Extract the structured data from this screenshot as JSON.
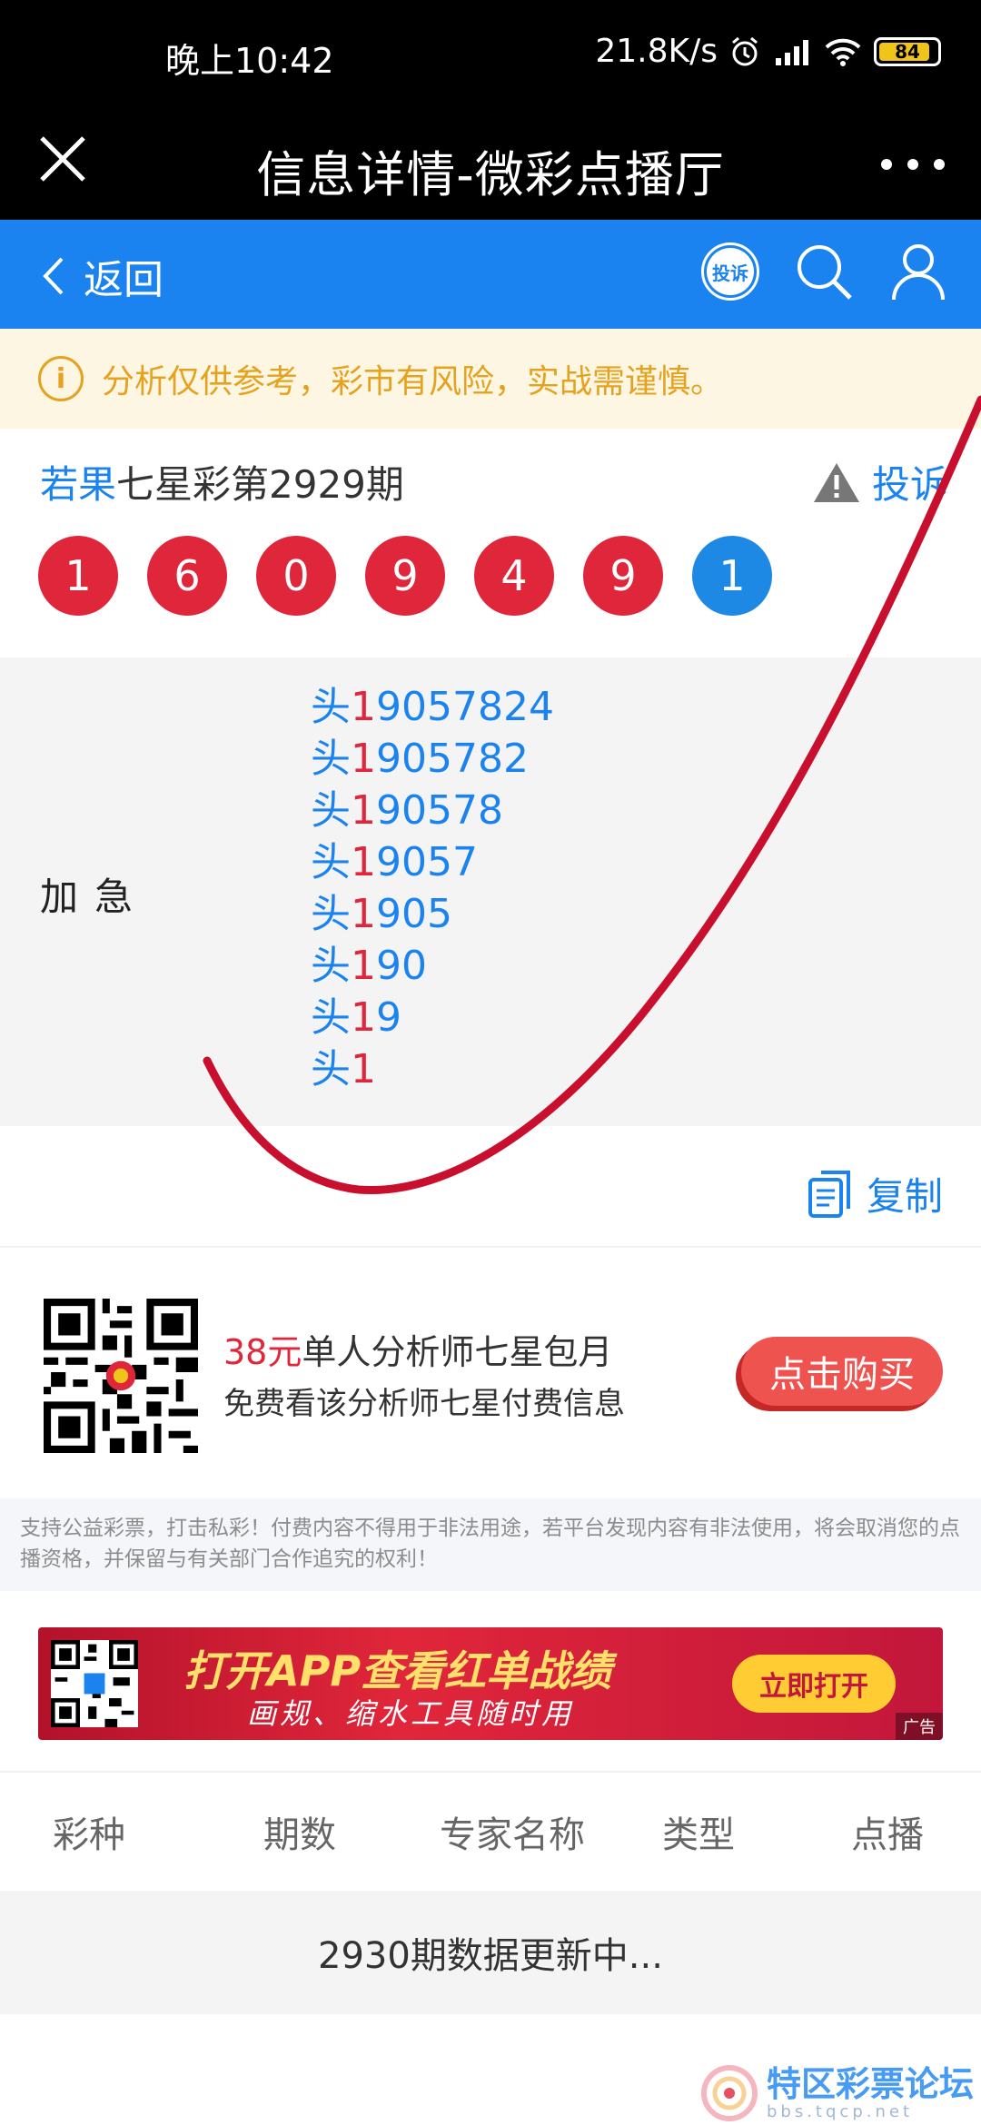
{
  "status_bar": {
    "time": "晚上10:42",
    "net_speed": "21.8K/s",
    "battery": "84"
  },
  "title_bar": {
    "title": "信息详情-微彩点播厅"
  },
  "nav": {
    "back_label": "返回",
    "complain_badge": "投诉"
  },
  "notice": {
    "text": "分析仅供参考，彩市有风险，实战需谨慎。"
  },
  "issue": {
    "author": "若果",
    "title": "七星彩第2929期",
    "report_label": "投诉"
  },
  "balls": {
    "b1": "1",
    "b2": "6",
    "b3": "0",
    "b4": "9",
    "b5": "4",
    "b6": "9",
    "b7": "1"
  },
  "detail": {
    "label": "加急",
    "lines": [
      {
        "prefix": "头",
        "first": "1",
        "rest": "9057824"
      },
      {
        "prefix": "头",
        "first": "1",
        "rest": "905782"
      },
      {
        "prefix": "头",
        "first": "1",
        "rest": "90578"
      },
      {
        "prefix": "头",
        "first": "1",
        "rest": "9057"
      },
      {
        "prefix": "头",
        "first": "1",
        "rest": "905"
      },
      {
        "prefix": "头",
        "first": "1",
        "rest": "90"
      },
      {
        "prefix": "头",
        "first": "1",
        "rest": "9"
      },
      {
        "prefix": "头",
        "first": "1",
        "rest": ""
      }
    ]
  },
  "copy_label": "复制",
  "promo": {
    "price": "38元",
    "title": "单人分析师七星包月",
    "subtitle": "免费看该分析师七星付费信息",
    "buy_label": "点击购买"
  },
  "disclaimer": "支持公益彩票，打击私彩！付费内容不得用于非法用途，若平台发现内容有非法使用，将会取消您的点播资格，并保留与有关部门合作追究的权利！",
  "banner": {
    "title": "打开APP查看红单战绩",
    "subtitle": "画规、缩水工具随时用",
    "open_label": "立即打开",
    "ad_tag": "广告"
  },
  "table": {
    "headers": [
      "彩种",
      "期数",
      "专家名称",
      "类型",
      "点播"
    ],
    "status_row": "2930期数据更新中..."
  },
  "watermark": {
    "name": "特区彩票论坛",
    "url": "bbs.tqcp.net"
  },
  "colors": {
    "nav_blue": "#1a83f0",
    "ball_red": "#e0263a",
    "notice_yellow": "#e5a21f"
  }
}
